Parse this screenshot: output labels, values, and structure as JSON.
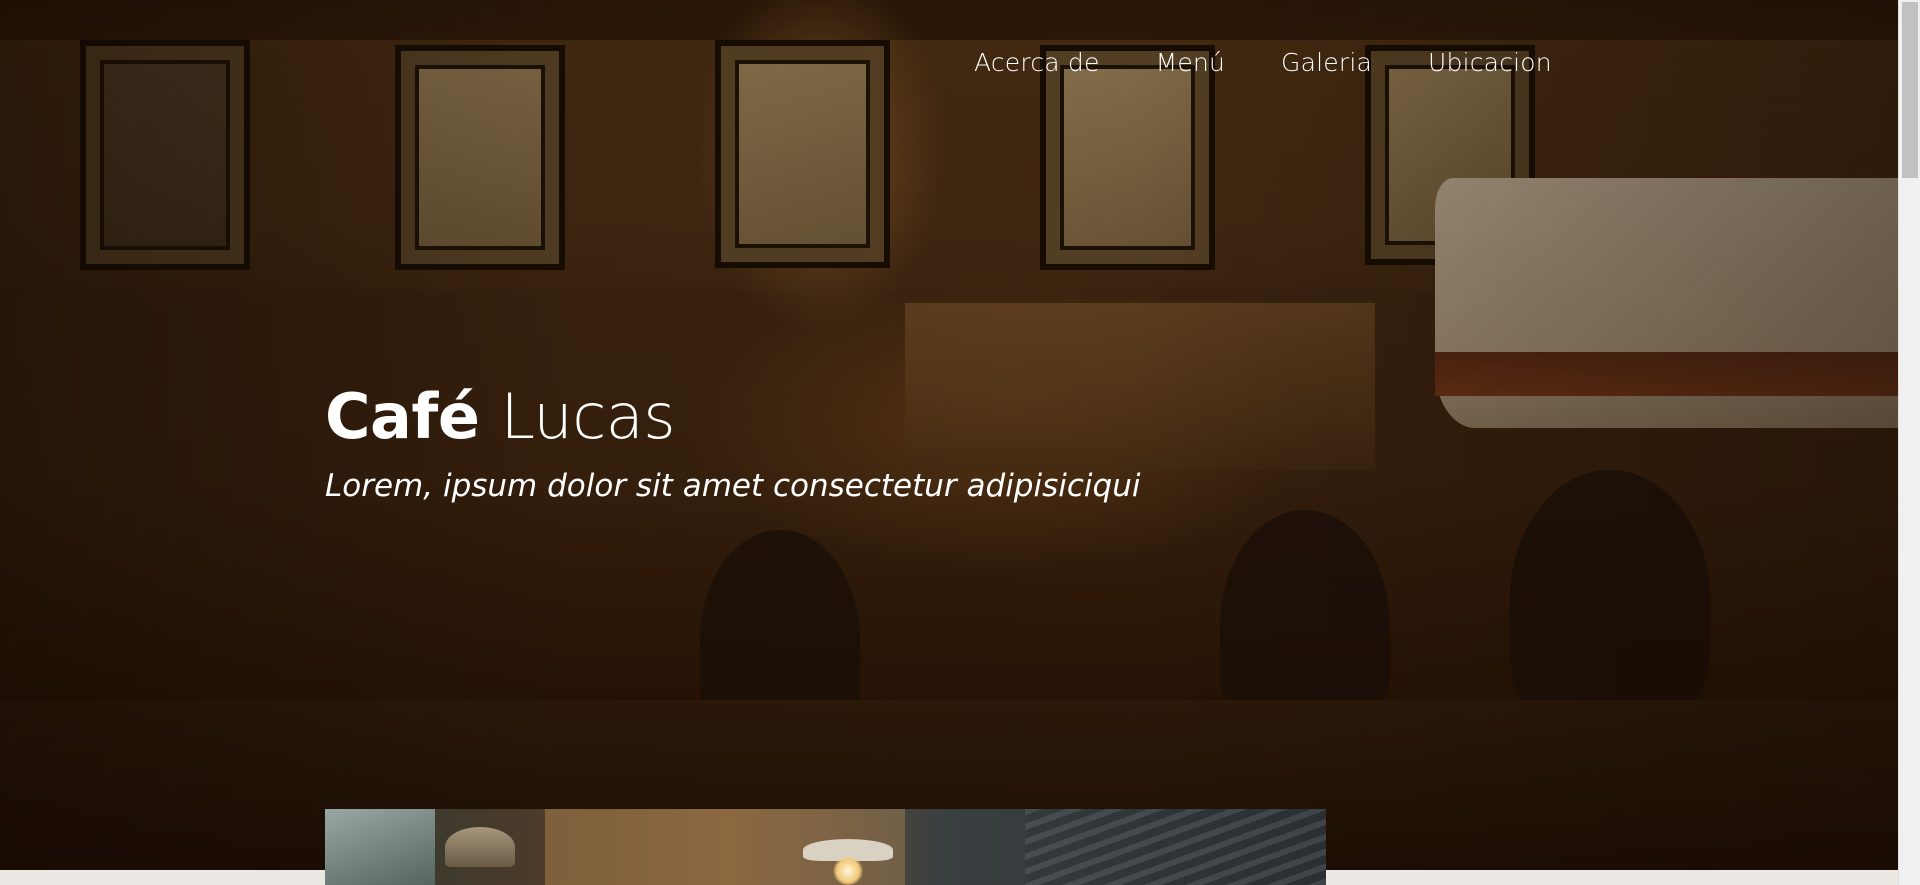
{
  "nav": {
    "items": [
      {
        "label": "Acerca de"
      },
      {
        "label": "Menú"
      },
      {
        "label": "Galeria"
      },
      {
        "label": "Ubicacion"
      }
    ]
  },
  "hero": {
    "brand_bold": "Café",
    "brand_light": "Lucas",
    "tagline": "Lorem, ipsum dolor sit amet consectetur adipisiciqui",
    "background_image": "cafe-interior-photo"
  },
  "preview": {
    "image": "cafe-ceiling-lamps-photo"
  },
  "colors": {
    "text": "#ffffff",
    "hero_tint": "#2b1707",
    "page_bg": "#ece8e3"
  }
}
